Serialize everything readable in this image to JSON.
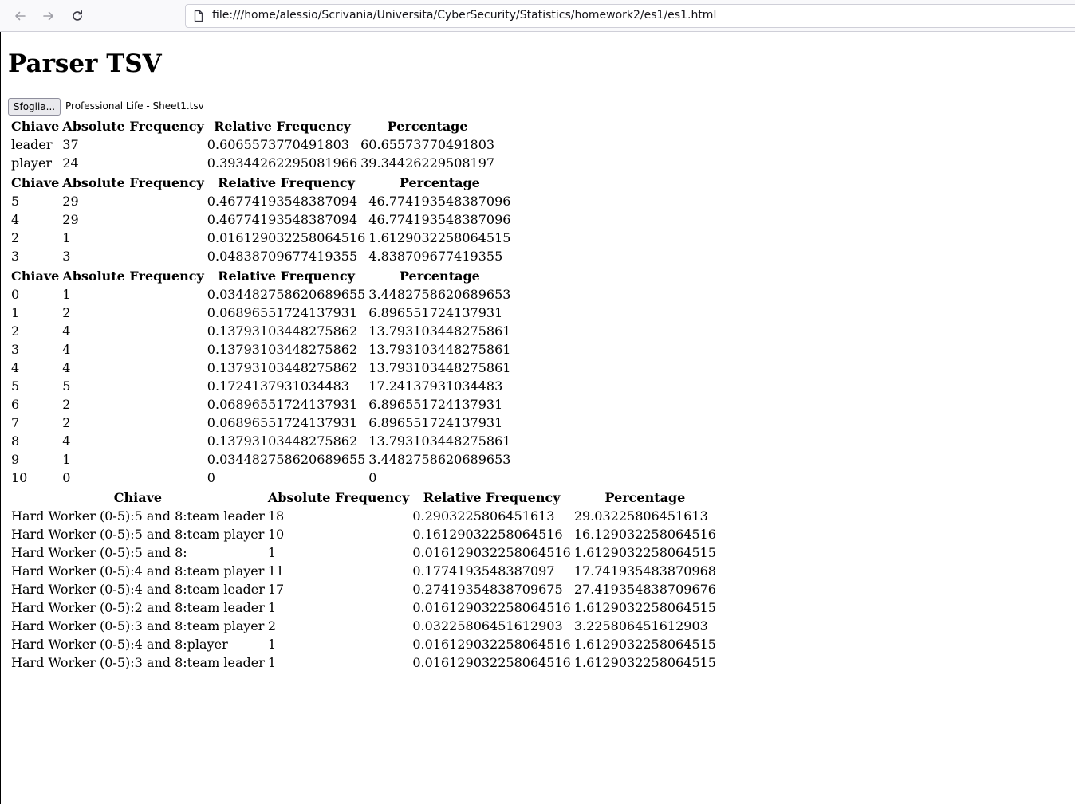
{
  "browser": {
    "url": "file:///home/alessio/Scrivania/Universita/CyberSecurity/Statistics/homework2/es1/es1.html"
  },
  "page": {
    "title": "Parser TSV",
    "browse_label": "Sfoglia...",
    "file_name": "Professional Life - Sheet1.tsv"
  },
  "tables": [
    {
      "headers": [
        "Chiave",
        "Absolute Frequency",
        "Relative Frequency",
        "Percentage"
      ],
      "rows": [
        [
          "leader",
          "37",
          "0.6065573770491803",
          "60.65573770491803"
        ],
        [
          "player",
          "24",
          "0.39344262295081966",
          "39.34426229508197"
        ]
      ]
    },
    {
      "headers": [
        "Chiave",
        "Absolute Frequency",
        "Relative Frequency",
        "Percentage"
      ],
      "rows": [
        [
          "5",
          "29",
          "0.46774193548387094",
          "46.774193548387096"
        ],
        [
          "4",
          "29",
          "0.46774193548387094",
          "46.774193548387096"
        ],
        [
          "2",
          "1",
          "0.016129032258064516",
          "1.6129032258064515"
        ],
        [
          "3",
          "3",
          "0.04838709677419355",
          "4.838709677419355"
        ]
      ]
    },
    {
      "headers": [
        "Chiave",
        "Absolute Frequency",
        "Relative Frequency",
        "Percentage"
      ],
      "rows": [
        [
          "0",
          "1",
          "0.034482758620689655",
          "3.4482758620689653"
        ],
        [
          "1",
          "2",
          "0.06896551724137931",
          "6.896551724137931"
        ],
        [
          "2",
          "4",
          "0.13793103448275862",
          "13.793103448275861"
        ],
        [
          "3",
          "4",
          "0.13793103448275862",
          "13.793103448275861"
        ],
        [
          "4",
          "4",
          "0.13793103448275862",
          "13.793103448275861"
        ],
        [
          "5",
          "5",
          "0.1724137931034483",
          "17.24137931034483"
        ],
        [
          "6",
          "2",
          "0.06896551724137931",
          "6.896551724137931"
        ],
        [
          "7",
          "2",
          "0.06896551724137931",
          "6.896551724137931"
        ],
        [
          "8",
          "4",
          "0.13793103448275862",
          "13.793103448275861"
        ],
        [
          "9",
          "1",
          "0.034482758620689655",
          "3.4482758620689653"
        ],
        [
          "10",
          "0",
          "0",
          "0"
        ]
      ]
    },
    {
      "headers": [
        "Chiave",
        "Absolute Frequency",
        "Relative Frequency",
        "Percentage"
      ],
      "rows": [
        [
          "Hard Worker (0-5):5 and 8:team leader",
          "18",
          "0.2903225806451613",
          "29.03225806451613"
        ],
        [
          "Hard Worker (0-5):5 and 8:team player",
          "10",
          "0.16129032258064516",
          "16.129032258064516"
        ],
        [
          "Hard Worker (0-5):5 and 8:",
          "1",
          "0.016129032258064516",
          "1.6129032258064515"
        ],
        [
          "Hard Worker (0-5):4 and 8:team player",
          "11",
          "0.1774193548387097",
          "17.741935483870968"
        ],
        [
          "Hard Worker (0-5):4 and 8:team leader",
          "17",
          "0.27419354838709675",
          "27.419354838709676"
        ],
        [
          "Hard Worker (0-5):2 and 8:team leader",
          "1",
          "0.016129032258064516",
          "1.6129032258064515"
        ],
        [
          "Hard Worker (0-5):3 and 8:team player",
          "2",
          "0.03225806451612903",
          "3.225806451612903"
        ],
        [
          "Hard Worker (0-5):4 and 8:player",
          "1",
          "0.016129032258064516",
          "1.6129032258064515"
        ],
        [
          "Hard Worker (0-5):3 and 8:team leader",
          "1",
          "0.016129032258064516",
          "1.6129032258064515"
        ]
      ]
    }
  ]
}
